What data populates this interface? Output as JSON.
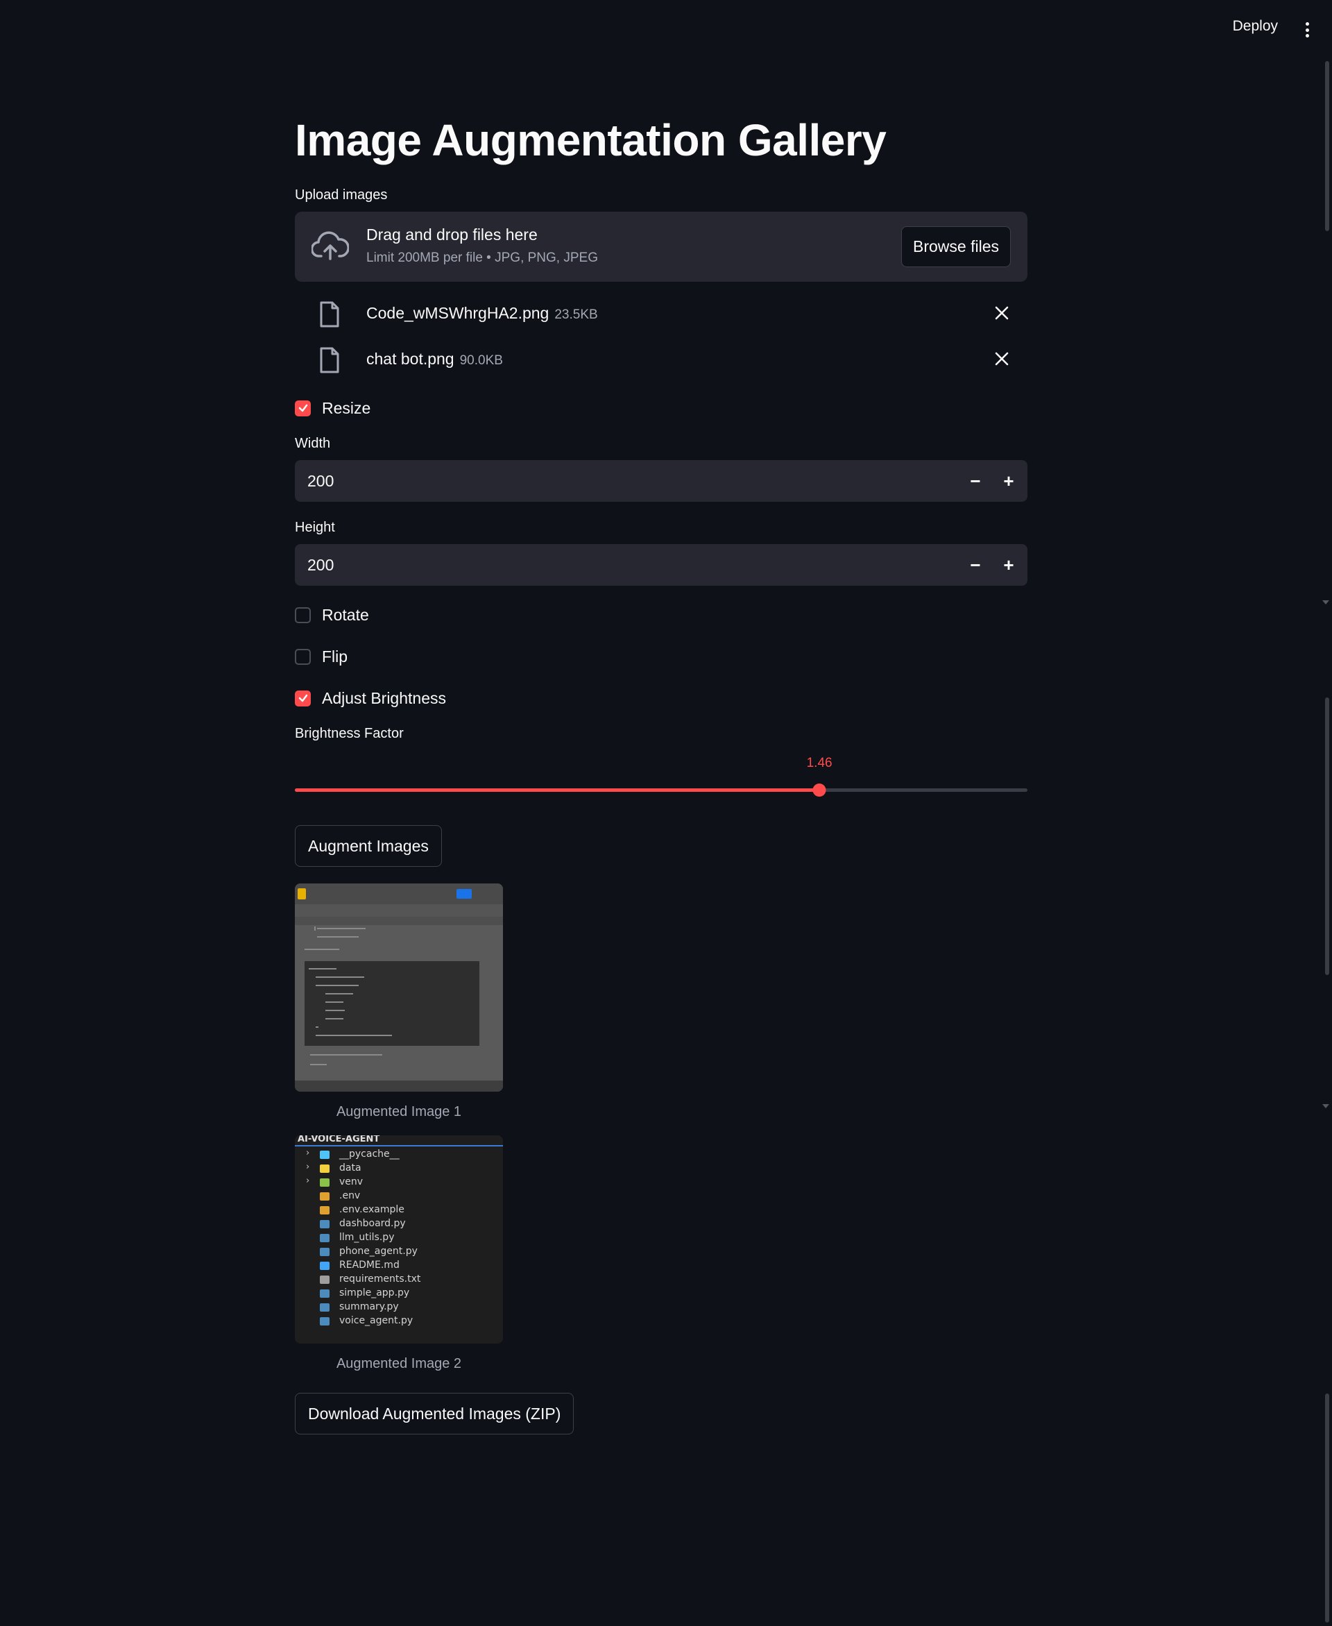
{
  "header": {
    "deploy_label": "Deploy",
    "menu_icon": "kebab-menu-icon"
  },
  "main": {
    "title": "Image Augmentation Gallery",
    "uploader": {
      "label": "Upload images",
      "drop_text": "Drag and drop files here",
      "limit_text": "Limit 200MB per file • JPG, PNG, JPEG",
      "browse_label": "Browse files",
      "files": [
        {
          "name": "Code_wMSWhrgHA2.png",
          "size": "23.5KB"
        },
        {
          "name": "chat bot.png",
          "size": "90.0KB"
        }
      ]
    },
    "resize": {
      "label": "Resize",
      "checked": true
    },
    "width": {
      "label": "Width",
      "value": "200"
    },
    "height": {
      "label": "Height",
      "value": "200"
    },
    "rotate": {
      "label": "Rotate",
      "checked": false
    },
    "flip": {
      "label": "Flip",
      "checked": false
    },
    "brightness": {
      "label": "Adjust Brightness",
      "checked": true
    },
    "brightness_factor": {
      "label": "Brightness Factor",
      "value": "1.46",
      "fraction": 0.716
    },
    "augment_button": "Augment Images",
    "gallery": [
      {
        "caption": "Augmented Image 1"
      },
      {
        "caption": "Augmented Image 2",
        "header": "AI-VOICE-AGENT",
        "tree": [
          {
            "name": "__pycache__",
            "type": "folder",
            "color": "#4fc3f7"
          },
          {
            "name": "data",
            "type": "folder",
            "color": "#f4d03f"
          },
          {
            "name": "venv",
            "type": "folder",
            "color": "#8bc34a"
          },
          {
            "name": ".env",
            "type": "file",
            "color": "#e0a030"
          },
          {
            "name": ".env.example",
            "type": "file",
            "color": "#e0a030"
          },
          {
            "name": "dashboard.py",
            "type": "file",
            "color": "#4b8bbe"
          },
          {
            "name": "llm_utils.py",
            "type": "file",
            "color": "#4b8bbe"
          },
          {
            "name": "phone_agent.py",
            "type": "file",
            "color": "#4b8bbe"
          },
          {
            "name": "README.md",
            "type": "file",
            "color": "#42a5f5"
          },
          {
            "name": "requirements.txt",
            "type": "file",
            "color": "#9e9e9e"
          },
          {
            "name": "simple_app.py",
            "type": "file",
            "color": "#4b8bbe"
          },
          {
            "name": "summary.py",
            "type": "file",
            "color": "#4b8bbe"
          },
          {
            "name": "voice_agent.py",
            "type": "file",
            "color": "#4b8bbe"
          }
        ]
      }
    ],
    "download_button": "Download Augmented Images (ZIP)"
  },
  "colors": {
    "accent": "#ff4b4b",
    "background": "#0e1117",
    "surface": "#262730"
  }
}
